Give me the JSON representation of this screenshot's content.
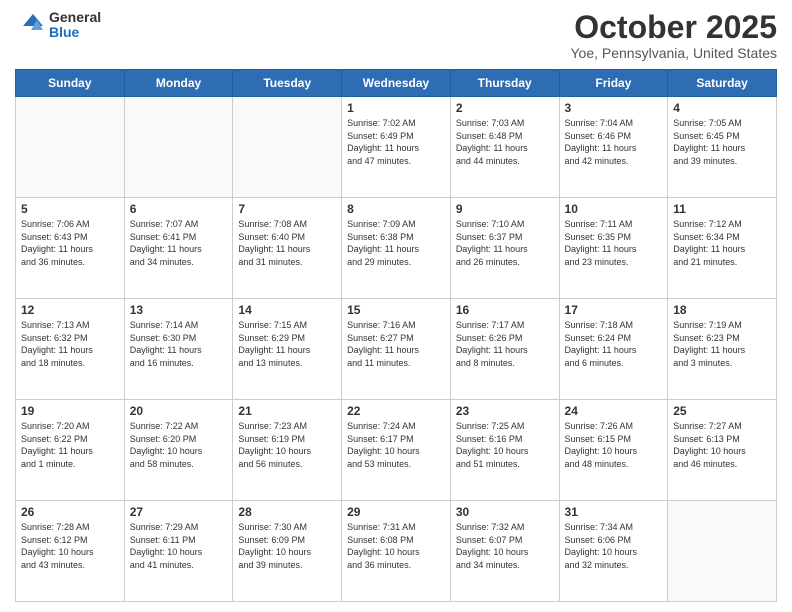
{
  "header": {
    "logo_general": "General",
    "logo_blue": "Blue",
    "month_title": "October 2025",
    "subtitle": "Yoe, Pennsylvania, United States"
  },
  "days_of_week": [
    "Sunday",
    "Monday",
    "Tuesday",
    "Wednesday",
    "Thursday",
    "Friday",
    "Saturday"
  ],
  "weeks": [
    [
      {
        "day": "",
        "info": ""
      },
      {
        "day": "",
        "info": ""
      },
      {
        "day": "",
        "info": ""
      },
      {
        "day": "1",
        "info": "Sunrise: 7:02 AM\nSunset: 6:49 PM\nDaylight: 11 hours\nand 47 minutes."
      },
      {
        "day": "2",
        "info": "Sunrise: 7:03 AM\nSunset: 6:48 PM\nDaylight: 11 hours\nand 44 minutes."
      },
      {
        "day": "3",
        "info": "Sunrise: 7:04 AM\nSunset: 6:46 PM\nDaylight: 11 hours\nand 42 minutes."
      },
      {
        "day": "4",
        "info": "Sunrise: 7:05 AM\nSunset: 6:45 PM\nDaylight: 11 hours\nand 39 minutes."
      }
    ],
    [
      {
        "day": "5",
        "info": "Sunrise: 7:06 AM\nSunset: 6:43 PM\nDaylight: 11 hours\nand 36 minutes."
      },
      {
        "day": "6",
        "info": "Sunrise: 7:07 AM\nSunset: 6:41 PM\nDaylight: 11 hours\nand 34 minutes."
      },
      {
        "day": "7",
        "info": "Sunrise: 7:08 AM\nSunset: 6:40 PM\nDaylight: 11 hours\nand 31 minutes."
      },
      {
        "day": "8",
        "info": "Sunrise: 7:09 AM\nSunset: 6:38 PM\nDaylight: 11 hours\nand 29 minutes."
      },
      {
        "day": "9",
        "info": "Sunrise: 7:10 AM\nSunset: 6:37 PM\nDaylight: 11 hours\nand 26 minutes."
      },
      {
        "day": "10",
        "info": "Sunrise: 7:11 AM\nSunset: 6:35 PM\nDaylight: 11 hours\nand 23 minutes."
      },
      {
        "day": "11",
        "info": "Sunrise: 7:12 AM\nSunset: 6:34 PM\nDaylight: 11 hours\nand 21 minutes."
      }
    ],
    [
      {
        "day": "12",
        "info": "Sunrise: 7:13 AM\nSunset: 6:32 PM\nDaylight: 11 hours\nand 18 minutes."
      },
      {
        "day": "13",
        "info": "Sunrise: 7:14 AM\nSunset: 6:30 PM\nDaylight: 11 hours\nand 16 minutes."
      },
      {
        "day": "14",
        "info": "Sunrise: 7:15 AM\nSunset: 6:29 PM\nDaylight: 11 hours\nand 13 minutes."
      },
      {
        "day": "15",
        "info": "Sunrise: 7:16 AM\nSunset: 6:27 PM\nDaylight: 11 hours\nand 11 minutes."
      },
      {
        "day": "16",
        "info": "Sunrise: 7:17 AM\nSunset: 6:26 PM\nDaylight: 11 hours\nand 8 minutes."
      },
      {
        "day": "17",
        "info": "Sunrise: 7:18 AM\nSunset: 6:24 PM\nDaylight: 11 hours\nand 6 minutes."
      },
      {
        "day": "18",
        "info": "Sunrise: 7:19 AM\nSunset: 6:23 PM\nDaylight: 11 hours\nand 3 minutes."
      }
    ],
    [
      {
        "day": "19",
        "info": "Sunrise: 7:20 AM\nSunset: 6:22 PM\nDaylight: 11 hours\nand 1 minute."
      },
      {
        "day": "20",
        "info": "Sunrise: 7:22 AM\nSunset: 6:20 PM\nDaylight: 10 hours\nand 58 minutes."
      },
      {
        "day": "21",
        "info": "Sunrise: 7:23 AM\nSunset: 6:19 PM\nDaylight: 10 hours\nand 56 minutes."
      },
      {
        "day": "22",
        "info": "Sunrise: 7:24 AM\nSunset: 6:17 PM\nDaylight: 10 hours\nand 53 minutes."
      },
      {
        "day": "23",
        "info": "Sunrise: 7:25 AM\nSunset: 6:16 PM\nDaylight: 10 hours\nand 51 minutes."
      },
      {
        "day": "24",
        "info": "Sunrise: 7:26 AM\nSunset: 6:15 PM\nDaylight: 10 hours\nand 48 minutes."
      },
      {
        "day": "25",
        "info": "Sunrise: 7:27 AM\nSunset: 6:13 PM\nDaylight: 10 hours\nand 46 minutes."
      }
    ],
    [
      {
        "day": "26",
        "info": "Sunrise: 7:28 AM\nSunset: 6:12 PM\nDaylight: 10 hours\nand 43 minutes."
      },
      {
        "day": "27",
        "info": "Sunrise: 7:29 AM\nSunset: 6:11 PM\nDaylight: 10 hours\nand 41 minutes."
      },
      {
        "day": "28",
        "info": "Sunrise: 7:30 AM\nSunset: 6:09 PM\nDaylight: 10 hours\nand 39 minutes."
      },
      {
        "day": "29",
        "info": "Sunrise: 7:31 AM\nSunset: 6:08 PM\nDaylight: 10 hours\nand 36 minutes."
      },
      {
        "day": "30",
        "info": "Sunrise: 7:32 AM\nSunset: 6:07 PM\nDaylight: 10 hours\nand 34 minutes."
      },
      {
        "day": "31",
        "info": "Sunrise: 7:34 AM\nSunset: 6:06 PM\nDaylight: 10 hours\nand 32 minutes."
      },
      {
        "day": "",
        "info": ""
      }
    ]
  ]
}
